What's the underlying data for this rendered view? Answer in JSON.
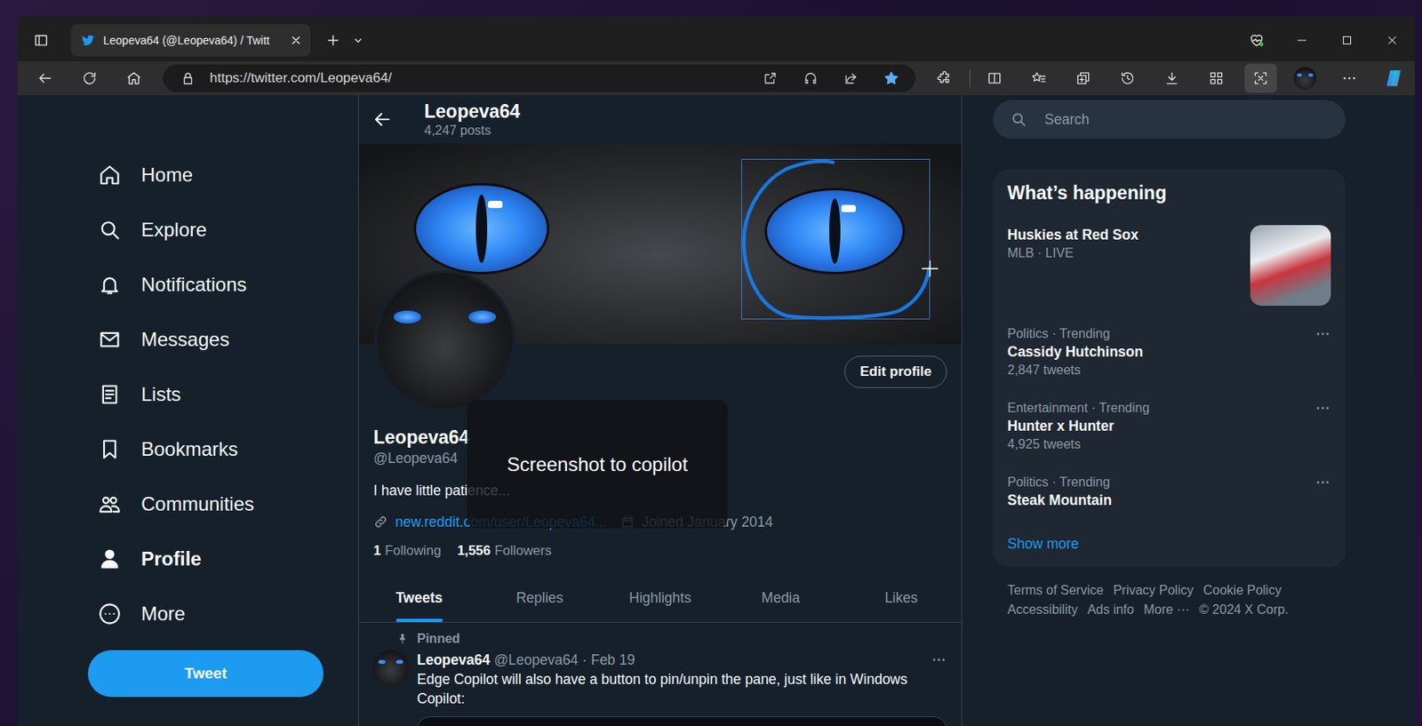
{
  "browser": {
    "tab": {
      "title": "Leopeva64 (@Leopeva64) / Twitt",
      "selected": true
    },
    "address": "https://twitter.com/Leopeva64/",
    "favorite": true,
    "screenshot_selected": true
  },
  "nav": [
    {
      "label": "Home",
      "selected": false
    },
    {
      "label": "Explore",
      "selected": false
    },
    {
      "label": "Notifications",
      "selected": false
    },
    {
      "label": "Messages",
      "selected": false
    },
    {
      "label": "Lists",
      "selected": false
    },
    {
      "label": "Bookmarks",
      "selected": false
    },
    {
      "label": "Communities",
      "selected": false
    },
    {
      "label": "Profile",
      "selected": true
    },
    {
      "label": "More",
      "selected": false
    }
  ],
  "tweet_button": "Tweet",
  "header": {
    "name": "Leopeva64",
    "posts": "4,247 posts"
  },
  "profile": {
    "edit_button": "Edit profile",
    "name": "Leopeva64",
    "handle": "@Leopeva64",
    "bio": "I have little patience...",
    "link": "new.reddit.com/user/Leopeva64...",
    "joined": "Joined January 2014",
    "following_count": "1",
    "following_label": "Following",
    "followers_count": "1,556",
    "followers_label": "Followers"
  },
  "profile_tabs": [
    {
      "label": "Tweets",
      "selected": true
    },
    {
      "label": "Replies",
      "selected": false
    },
    {
      "label": "Highlights",
      "selected": false
    },
    {
      "label": "Media",
      "selected": false
    },
    {
      "label": "Likes",
      "selected": false
    }
  ],
  "pinned_tweet": {
    "pinned_label": "Pinned",
    "author": "Leopeva64",
    "handle": "@Leopeva64",
    "separator": "·",
    "date": "Feb 19",
    "text": "Edge Copilot will also have a button to pin/unpin the pane, just like in Windows Copilot:"
  },
  "screenshot_overlay": {
    "label": "Screenshot to copilot"
  },
  "search": {
    "placeholder": "Search"
  },
  "trends": {
    "title": "What’s happening",
    "items": [
      {
        "kind": "event",
        "name": "Huskies at Red Sox",
        "meta": "MLB · LIVE"
      },
      {
        "kind": "trend",
        "category": "Politics · Trending",
        "name": "Cassidy Hutchinson",
        "count": "2,847 tweets"
      },
      {
        "kind": "trend",
        "category": "Entertainment · Trending",
        "name": "Hunter x Hunter",
        "count": "4,925 tweets"
      },
      {
        "kind": "trend",
        "category": "Politics · Trending",
        "name": "Steak Mountain"
      }
    ],
    "show_more": "Show more"
  },
  "footer": [
    "Terms of Service",
    "Privacy Policy",
    "Cookie Policy",
    "Accessibility",
    "Ads info",
    "More ···",
    "© 2024 X Corp."
  ]
}
